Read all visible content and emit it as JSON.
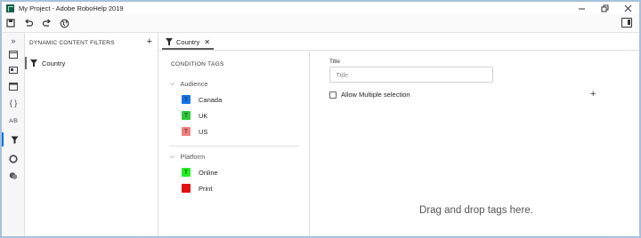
{
  "window": {
    "title": "My Project - Adobe RoboHelp 2019",
    "controls": [
      "minimize",
      "restore",
      "close"
    ]
  },
  "toolbar": {
    "icons": [
      "save-icon",
      "undo-icon",
      "redo-icon",
      "globe-icon"
    ],
    "right_icon": "panel-toggle-icon"
  },
  "rail": {
    "icons": [
      "expand-icon",
      "contents-icon",
      "snippets-icon",
      "master-pages-icon",
      "variables-icon",
      "ab-icon",
      "filter-icon",
      "circle-icon",
      "reviews-icon"
    ],
    "ab_label": "A/B",
    "expand_label": "»",
    "braces_label": "{ }",
    "active": "filter-icon"
  },
  "filters_panel": {
    "header": "DYNAMIC CONTENT FILTERS",
    "add_label": "+",
    "items": [
      {
        "label": "Country"
      }
    ]
  },
  "tab": {
    "label": "Country",
    "close_label": "✕"
  },
  "tags_panel": {
    "title": "CONDITION TAGS",
    "groups": [
      {
        "name": "Audience",
        "tags": [
          {
            "letter": "T",
            "label": "Canada",
            "color": "#1473e6"
          },
          {
            "letter": "T",
            "label": "UK",
            "color": "#2fc93a"
          },
          {
            "letter": "T",
            "label": "US",
            "color": "#f08080"
          }
        ]
      },
      {
        "name": "Platform",
        "tags": [
          {
            "letter": "T",
            "label": "Online",
            "color": "#22ee22"
          },
          {
            "letter": "",
            "label": "Print",
            "color": "#e01010"
          }
        ]
      }
    ]
  },
  "detail": {
    "title_label": "Title",
    "title_placeholder": "Title",
    "title_value": "",
    "multi_label": "Allow Multiple selection",
    "multi_checked": false,
    "add_label": "+",
    "drop_hint": "Drag and drop tags here."
  }
}
